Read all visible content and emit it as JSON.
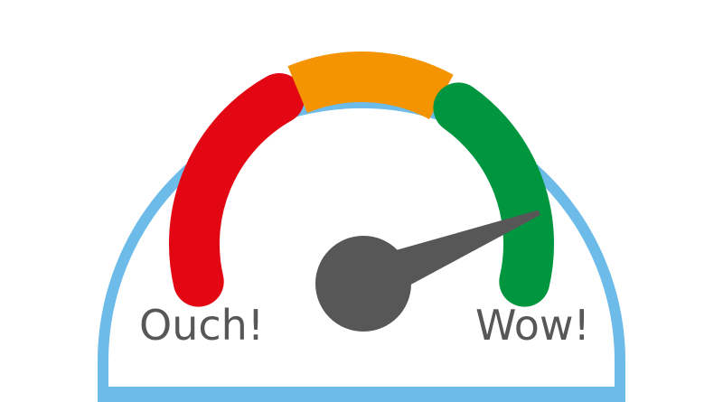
{
  "gauge": {
    "left_label": "Ouch!",
    "right_label": "Wow!",
    "needle_level": 0.83,
    "colors": {
      "frame": "#6dbbe8",
      "background": "#ffffff",
      "red": "#e30613",
      "orange": "#f39400",
      "green": "#009640",
      "needle": "#575757",
      "label": "#575757"
    },
    "segments": [
      {
        "name": "red",
        "color": "#e30613"
      },
      {
        "name": "orange",
        "color": "#f39400"
      },
      {
        "name": "green",
        "color": "#009640"
      }
    ]
  }
}
